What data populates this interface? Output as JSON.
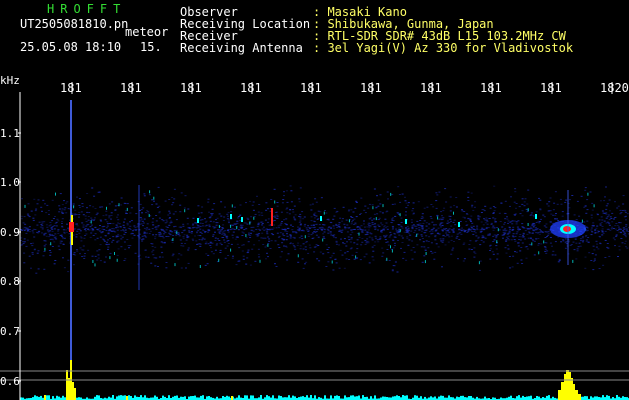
{
  "header": {
    "program": "HROFFT",
    "file_name": "UT2505081810.pn",
    "file_tag": "meteor",
    "datetime": "25.05.08 18:10",
    "minute": "15.",
    "fields": [
      {
        "label": "Observer",
        "value": ": Masaki Kano"
      },
      {
        "label": "Receiving Location",
        "value": ": Shibukawa, Gunma, Japan"
      },
      {
        "label": "Receiver",
        "value": ": RTL-SDR SDR# 43dB L15 103.2MHz CW"
      },
      {
        "label": "Receiving Antenna",
        "value": ": 3el Yagi(V) Az 330 for Vladivostok"
      }
    ]
  },
  "axes": {
    "y_unit": "kHz",
    "y_ticks": [
      "1.1",
      "1.0",
      "0.9",
      "0.8",
      "0.7",
      "0.6"
    ],
    "x_ticks": [
      "181",
      "181",
      "181",
      "181",
      "181",
      "181",
      "181",
      "181",
      "181",
      "1820"
    ]
  },
  "colors": {
    "background": "#000000",
    "text": "#ffffff",
    "header_values": "#ffff66",
    "program_name": "#33dd33",
    "noise_band": "#1a2ab0",
    "echo_hot": "#ff2020",
    "echo_warm": "#ffff00",
    "echo_cyan": "#00ffff",
    "level_line": "#00ffff",
    "level_spike": "#ffff00"
  }
}
